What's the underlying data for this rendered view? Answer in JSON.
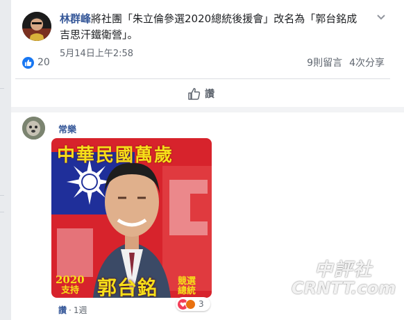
{
  "post": {
    "author": "林群峰",
    "text": "將社團「朱立倫參選2020總統後援會」改名為「郭台銘成吉思汗鐵衛營」。",
    "timestamp": "5月14日上午2:58",
    "like_count": "20",
    "comments_count": "9則留言",
    "shares_count": "4次分享",
    "like_action": "讚"
  },
  "comment": {
    "author": "常樂",
    "image_text": {
      "banner": "中華民國萬歲",
      "year": "2020",
      "support": "支持",
      "name": "郭台銘",
      "side1": "競選",
      "side2": "總統"
    },
    "reaction_count": "3",
    "like_label": "讚",
    "separator": "·",
    "age": "1週"
  },
  "watermark": {
    "line1": "中評社",
    "line2": "CRNTT.com"
  },
  "colors": {
    "link": "#365899",
    "like_blue": "#1877f2",
    "heart": "#f33e58",
    "banner_yellow": "#f6df1a",
    "flag_blue": "#1f2f9a",
    "flag_red": "#d7232c"
  }
}
